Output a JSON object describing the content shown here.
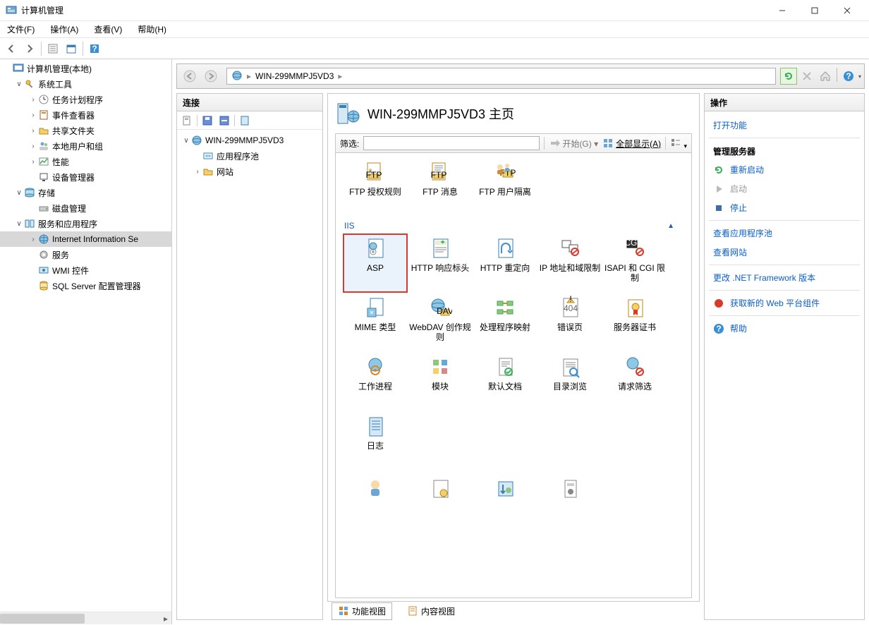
{
  "window": {
    "title": "计算机管理"
  },
  "menu": {
    "file": "文件(F)",
    "action": "操作(A)",
    "view": "查看(V)",
    "help": "帮助(H)"
  },
  "leftTree": {
    "root": "计算机管理(本地)",
    "sysTools": "系统工具",
    "taskSched": "任务计划程序",
    "eventViewer": "事件查看器",
    "sharedFolders": "共享文件夹",
    "localUsers": "本地用户和组",
    "performance": "性能",
    "deviceMgr": "设备管理器",
    "storage": "存储",
    "diskMgmt": "磁盘管理",
    "services": "服务和应用程序",
    "iis": "Internet Information Se",
    "servicesNode": "服务",
    "wmi": "WMI 控件",
    "sql": "SQL Server 配置管理器"
  },
  "addr": {
    "server": "WIN-299MMPJ5VD3"
  },
  "cols": {
    "connections": "连接",
    "actions": "操作"
  },
  "connTree": {
    "server": "WIN-299MMPJ5VD3",
    "appPools": "应用程序池",
    "sites": "网站"
  },
  "center": {
    "title": "WIN-299MMPJ5VD3 主页",
    "filterLabel": "筛选:",
    "go": "开始(G)",
    "showAll": "全部显示(A)",
    "groupFTP": "",
    "groupIIS": "IIS",
    "ftpItems": {
      "authRules": "FTP 授权规则",
      "messages": "FTP 消息",
      "userIsolation": "FTP 用户隔离"
    },
    "iisItems": {
      "asp": "ASP",
      "httpResp": "HTTP 响应标头",
      "httpRedir": "HTTP 重定向",
      "ipRestr": "IP 地址和域限制",
      "isapiCgi": "ISAPI 和 CGI 限制",
      "mime": "MIME 类型",
      "webdav": "WebDAV 创作规则",
      "handlerMap": "处理程序映射",
      "errorPages": "错误页",
      "serverCerts": "服务器证书",
      "workerProc": "工作进程",
      "modules": "模块",
      "defaultDoc": "默认文档",
      "dirBrowse": "目录浏览",
      "reqFilter": "请求筛选",
      "logging": "日志"
    },
    "tabFeature": "功能视图",
    "tabContent": "内容视图"
  },
  "actions": {
    "open": "打开功能",
    "manageServer": "管理服务器",
    "restart": "重新启动",
    "start": "启动",
    "stop": "停止",
    "viewAppPools": "查看应用程序池",
    "viewSites": "查看网站",
    "changeNet": "更改 .NET Framework 版本",
    "getWebPlatform": "获取新的 Web 平台组件",
    "help": "帮助"
  }
}
